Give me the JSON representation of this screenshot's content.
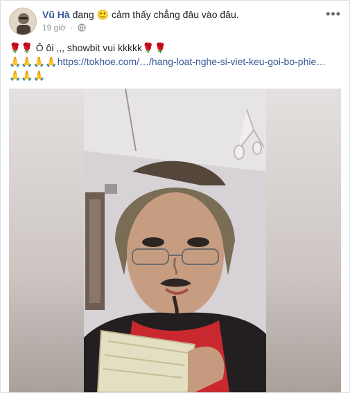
{
  "post": {
    "author": "Vũ Hà",
    "feeling_prefix": "đang",
    "feeling_text": "cảm thấy chẳng đâu vào đâu.",
    "feeling_emoji": "🙂",
    "time": "19 giờ",
    "dot": "·",
    "privacy_icon": "globe-icon",
    "menu": "•••",
    "line1_emoji": "🌹🌹",
    "line1_text": "Ô ôi ,,, showbit vui kkkkk",
    "line1_emoji_end": "🌹🌹",
    "line2_emoji": "🙏🙏🙏🙏",
    "link_text": "https://tokhoe.com/…/hang-loat-nghe-si-viet-keu-goi-bo-phie…",
    "line3_emoji": "🙏🙏🙏"
  },
  "colors": {
    "link": "#365899",
    "meta": "#90949c",
    "text": "#1d2129"
  }
}
